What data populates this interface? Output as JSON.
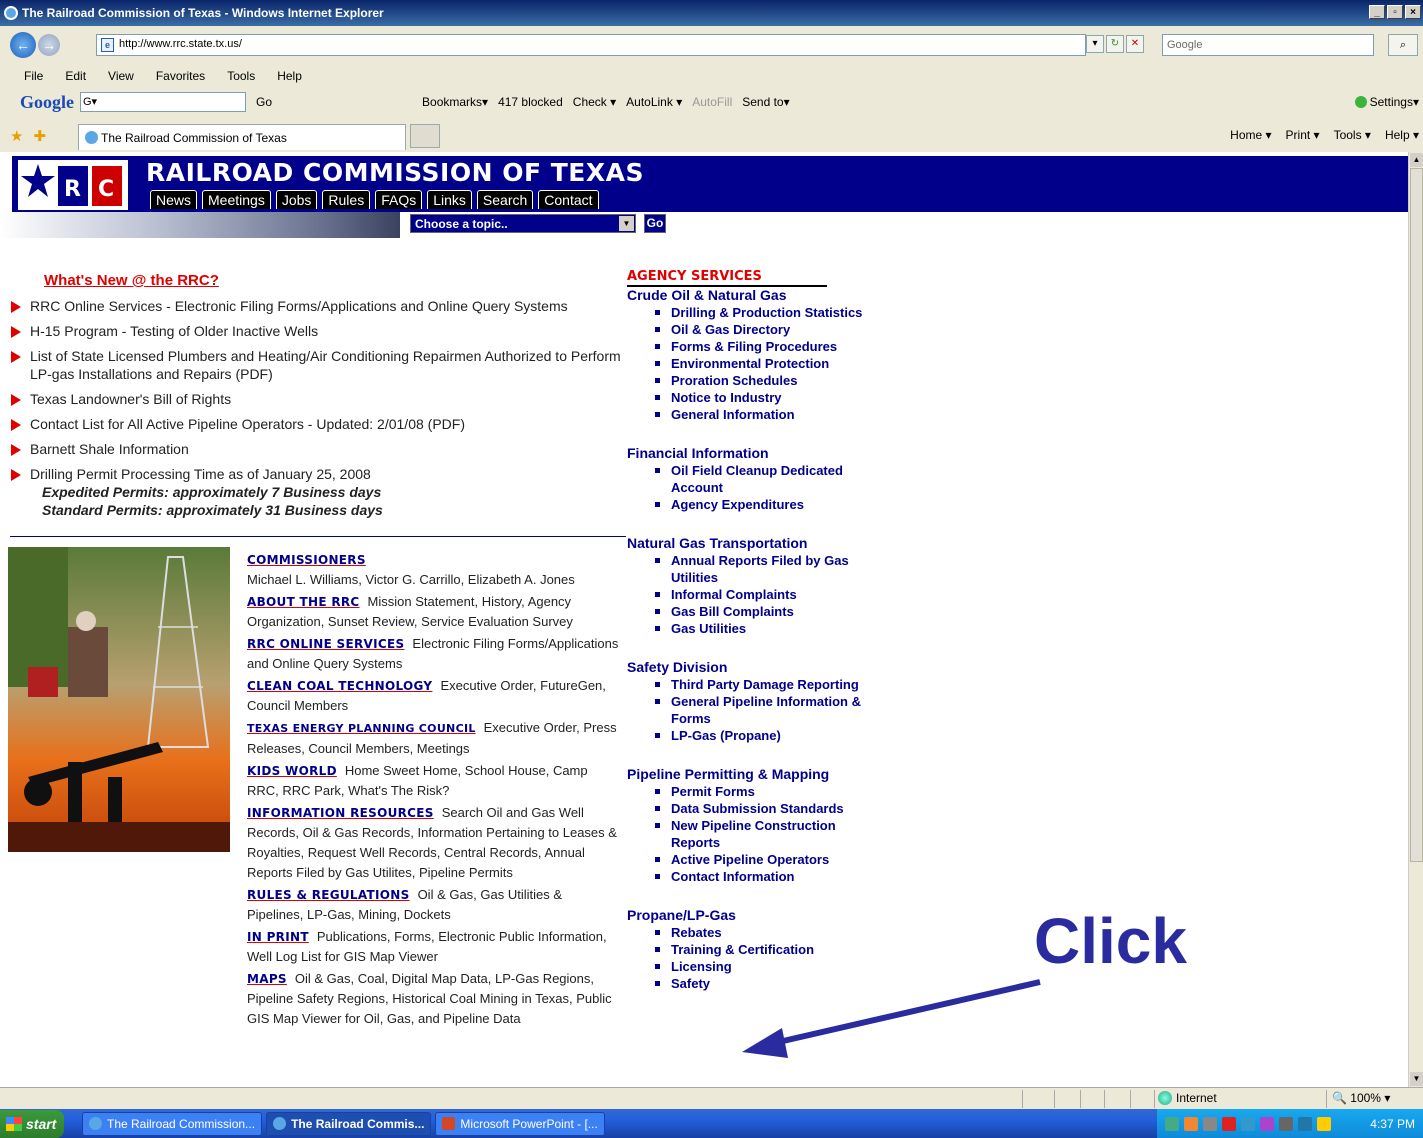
{
  "window": {
    "title": "The Railroad Commission of Texas - Windows Internet Explorer"
  },
  "browser": {
    "url": "http://www.rrc.state.tx.us/",
    "search_placeholder": "Google",
    "menu": [
      "File",
      "Edit",
      "View",
      "Favorites",
      "Tools",
      "Help"
    ],
    "google_toolbar": {
      "logo": "Google",
      "field": "G▾",
      "go": "Go",
      "bookmarks": "Bookmarks▾",
      "blocked": "417 blocked",
      "check": "Check ▾",
      "autolink": "AutoLink ▾",
      "autofill": "AutoFill",
      "sendto": "Send to▾",
      "settings": "Settings▾"
    },
    "tab_title": "The Railroad Commission of Texas",
    "commands": [
      "Home ▾",
      "Print ▾",
      "Tools ▾",
      "Help ▾"
    ]
  },
  "site": {
    "title": "RAILROAD COMMISSION OF TEXAS",
    "nav": [
      "News",
      "Meetings",
      "Jobs",
      "Rules",
      "FAQs",
      "Links",
      "Search",
      "Contact"
    ],
    "topic_select": "Choose a topic..",
    "go": "Go"
  },
  "whats_new": {
    "heading": "What's New @ the RRC?",
    "items": [
      "RRC Online Services - Electronic Filing Forms/Applications and Online Query Systems",
      "H-15 Program - Testing of Older Inactive Wells",
      "List of State Licensed Plumbers and Heating/Air Conditioning Repairmen Authorized to Perform LP-gas Installations and Repairs (PDF)",
      "Texas Landowner's Bill of Rights",
      "Contact List for All Active Pipeline Operators - Updated: 2/01/08 (PDF)",
      "Barnett Shale Information",
      "Drilling Permit Processing Time as of January 25, 2008"
    ],
    "sub1": "Expedited Permits: approximately 7 Business days",
    "sub2": "Standard Permits: approximately 31 Business days"
  },
  "info_sections": [
    {
      "head": "Commissioners",
      "text": "Michael L. Williams, Victor G. Carrillo, Elizabeth A. Jones"
    },
    {
      "head": "About the RRC",
      "text": "Mission Statement, History, Agency Organization, Sunset Review, Service Evaluation Survey"
    },
    {
      "head": "RRC Online Services",
      "text": "Electronic Filing Forms/Applications and Online Query Systems"
    },
    {
      "head": "Clean Coal Technology",
      "text": "Executive Order, FutureGen, Council Members"
    },
    {
      "head": "Texas Energy Planning Council",
      "text": "Executive Order, Press Releases, Council Members, Meetings"
    },
    {
      "head": "Kids World",
      "text": "Home Sweet Home, School House, Camp RRC, RRC Park, What's The Risk?"
    },
    {
      "head": "Information Resources",
      "text": "Search Oil and Gas Well Records, Oil & Gas Records, Information Pertaining to Leases & Royalties, Request Well Records, Central Records, Annual Reports Filed by Gas Utilites, Pipeline Permits"
    },
    {
      "head": "Rules & Regulations",
      "text": "Oil & Gas, Gas Utilities & Pipelines, LP-Gas, Mining, Dockets"
    },
    {
      "head": "In Print",
      "text": "Publications, Forms, Electronic Public Information, Well Log List for GIS Map Viewer"
    },
    {
      "head": "Maps",
      "text": "Oil & Gas, Coal, Digital Map Data, LP-Gas Regions, Pipeline Safety Regions, Historical Coal Mining in Texas, Public GIS Map Viewer for Oil, Gas, and Pipeline Data"
    }
  ],
  "agency": {
    "heading": "AGENCY SERVICES",
    "sections": [
      {
        "title": "Crude Oil & Natural Gas",
        "links": [
          "Drilling & Production Statistics",
          "Oil & Gas Directory",
          "Forms & Filing Procedures",
          "Environmental Protection",
          "Proration Schedules",
          "Notice to Industry",
          "General Information"
        ]
      },
      {
        "title": "Financial Information",
        "links": [
          "Oil Field Cleanup Dedicated Account",
          "Agency Expenditures"
        ]
      },
      {
        "title": "Natural Gas Transportation",
        "links": [
          "Annual Reports Filed by Gas Utilities",
          "Informal Complaints",
          "Gas Bill Complaints",
          "Gas Utilities"
        ]
      },
      {
        "title": "Safety Division",
        "links": [
          "Third Party Damage Reporting",
          "General Pipeline Information & Forms",
          "LP-Gas (Propane)"
        ]
      },
      {
        "title": "Pipeline Permitting & Mapping",
        "links": [
          "Permit Forms",
          "Data Submission Standards",
          "New Pipeline Construction Reports",
          "Active Pipeline Operators",
          "Contact Information"
        ]
      },
      {
        "title": "Propane/LP-Gas",
        "links": [
          "Rebates",
          "Training & Certification",
          "Licensing",
          "Safety"
        ]
      }
    ]
  },
  "annotation": {
    "label": "Click"
  },
  "status": {
    "zone": "Internet",
    "zoom": "100%"
  },
  "taskbar": {
    "start": "start",
    "items": [
      "The Railroad Commission...",
      "The Railroad Commis...",
      "Microsoft PowerPoint - [..."
    ],
    "clock": "4:37 PM"
  }
}
